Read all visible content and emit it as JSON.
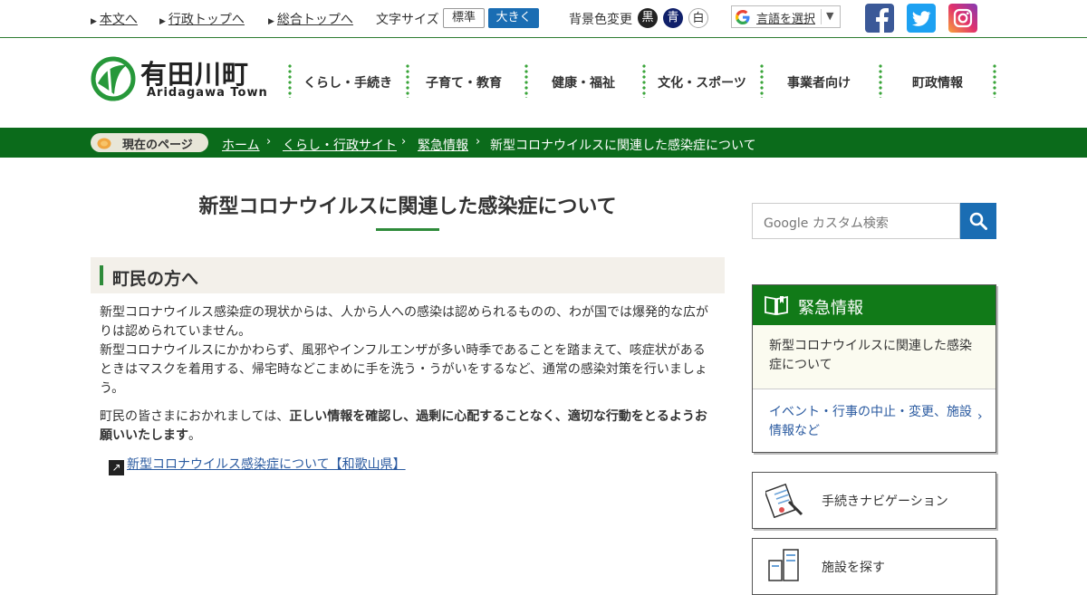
{
  "topbar": {
    "skip_to_content": "本文へ",
    "admin_top": "行政トップへ",
    "general_top": "総合トップへ",
    "font_size_label": "文字サイズ",
    "font_standard": "標準",
    "font_large": "大きく",
    "bg_color_label": "背景色変更",
    "bg_black": "黒",
    "bg_blue": "青",
    "bg_white": "白",
    "translate_label": "言語を選択",
    "translate_arrow": "▼",
    "social": [
      "facebook-icon",
      "twitter-icon",
      "instagram-icon"
    ]
  },
  "header": {
    "logo_jp": "有田川町",
    "logo_en": "Aridagawa Town",
    "nav": [
      "くらし・手続き",
      "子育て・教育",
      "健康・福祉",
      "文化・スポーツ",
      "事業者向け",
      "町政情報"
    ]
  },
  "breadcrumb": {
    "label": "現在のページ",
    "items": [
      "ホーム",
      "くらし・行政サイト",
      "緊急情報"
    ],
    "current": "新型コロナウイルスに関連した感染症について"
  },
  "main": {
    "title": "新型コロナウイルスに関連した感染症について",
    "section_heading": "町民の方へ",
    "para1": "新型コロナウイルス感染症の現状からは、人から人への感染は認められるものの、わが国では爆発的な広がりは認められていません。",
    "para2": "新型コロナウイルスにかかわらず、風邪やインフルエンザが多い時季であることを踏まえて、咳症状があるときはマスクを着用する、帰宅時などこまめに手を洗う・うがいをするなど、通常の感染対策を行いましょう。",
    "para3_prefix": "町民の皆さまにおかれましては、",
    "para3_bold": "正しい情報を確認し、過剰に心配することなく、適切な行動をとるようお願いいたします",
    "para3_suffix": "。",
    "external_link": "新型コロナウイルス感染症について【和歌山県】"
  },
  "sidebar": {
    "search_placeholder": "Google カスタム検索",
    "emergency_title": "緊急情報",
    "emergency_items": [
      "新型コロナウイルスに関連した感染症について",
      "イベント・行事の中止・変更、施設情報など"
    ],
    "cards": [
      "手続きナビゲーション",
      "施設を探す"
    ]
  },
  "colors": {
    "brand_green": "#0b6b1b",
    "accent_green": "#2e8b3a",
    "link_blue": "#2a5aa0",
    "search_blue": "#1a6db3"
  }
}
